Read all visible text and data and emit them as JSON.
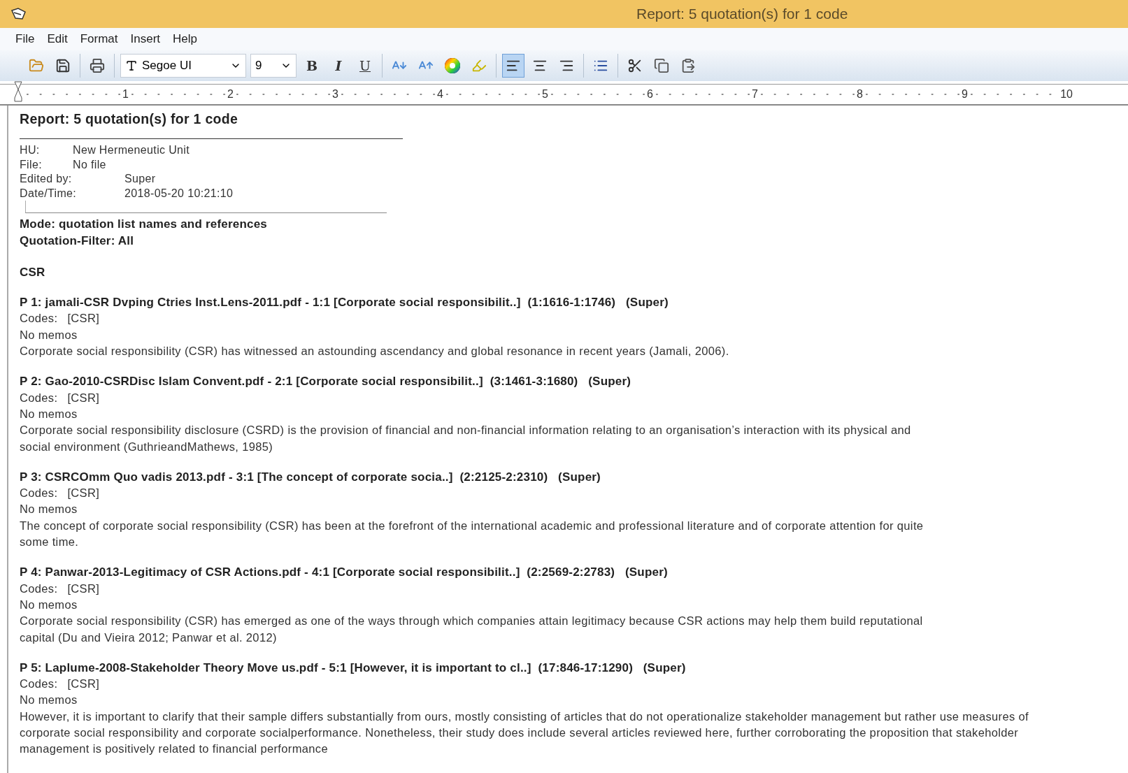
{
  "window": {
    "title": "Report: 5 quotation(s) for 1 code"
  },
  "menu": [
    "File",
    "Edit",
    "Format",
    "Insert",
    "Help"
  ],
  "toolbar": {
    "groups": [
      [
        {
          "kind": "open"
        },
        {
          "kind": "save"
        }
      ],
      [
        {
          "kind": "print"
        }
      ],
      [
        {
          "kind": "font",
          "value": "Segoe UI"
        },
        {
          "kind": "size",
          "value": "9"
        },
        {
          "kind": "bold",
          "label": "B"
        },
        {
          "kind": "italic",
          "label": "I"
        },
        {
          "kind": "underline",
          "label": "U"
        }
      ],
      [
        {
          "kind": "shrink"
        },
        {
          "kind": "grow"
        },
        {
          "kind": "color"
        },
        {
          "kind": "highlight"
        }
      ],
      [
        {
          "kind": "align-left",
          "selected": true
        },
        {
          "kind": "align-center",
          "selected": false
        },
        {
          "kind": "align-right",
          "selected": false
        }
      ],
      [
        {
          "kind": "bullets"
        }
      ],
      [
        {
          "kind": "cut"
        },
        {
          "kind": "copy"
        },
        {
          "kind": "paste"
        }
      ]
    ]
  },
  "ruler": [
    "1",
    "2",
    "3",
    "4",
    "5",
    "6",
    "7",
    "8",
    "9",
    "10"
  ],
  "document": {
    "title": "Report: 5 quotation(s) for 1 code",
    "meta": [
      {
        "label": "HU:",
        "value": "New Hermeneutic Unit"
      },
      {
        "label": "File:",
        "value": "No file"
      },
      {
        "label": "Edited by:",
        "value": "Super"
      },
      {
        "label": "Date/Time:",
        "value": "2018-05-20 10:21:10"
      }
    ],
    "mode": "Mode: quotation list names and references",
    "filter": "Quotation-Filter: All",
    "code": "CSR",
    "quotations": [
      {
        "heading": "P 1: jamali-CSR Dvping Ctries Inst.Lens-2011.pdf - 1:1 [Corporate social responsibilit..]  (1:1616-1:1746)   (Super)",
        "codes_label": "Codes:",
        "codes": "[CSR]",
        "memos": "No memos",
        "lines": [
          "Corporate social responsibility (CSR) has witnessed an astounding ascendancy and global resonance in recent years (Jamali, 2006)."
        ]
      },
      {
        "heading": "P 2: Gao-2010-CSRDisc Islam Convent.pdf - 2:1 [Corporate social responsibilit..]  (3:1461-3:1680)   (Super)",
        "codes_label": "Codes:",
        "codes": "[CSR]",
        "memos": "No memos",
        "lines": [
          "Corporate social responsibility disclosure (CSRD) is the provision of financial and non-financial information relating to an organisation’s interaction with its physical and",
          "social environment (GuthrieandMathews, 1985)"
        ]
      },
      {
        "heading": "P 3: CSRCOmm Quo vadis 2013.pdf - 3:1 [The concept of corporate socia..]  (2:2125-2:2310)   (Super)",
        "codes_label": "Codes:",
        "codes": "[CSR]",
        "memos": "No memos",
        "lines": [
          "The concept of corporate social responsibility (CSR) has been at the forefront of the international academic and professional literature and of corporate attention for quite",
          "some time."
        ]
      },
      {
        "heading": "P 4: Panwar-2013-Legitimacy of CSR Actions.pdf - 4:1 [Corporate social responsibilit..]  (2:2569-2:2783)   (Super)",
        "codes_label": "Codes:",
        "codes": "[CSR]",
        "memos": "No memos",
        "lines": [
          "Corporate social responsibility (CSR) has emerged as one of the ways through which companies attain legitimacy because CSR actions may help them build reputational",
          "capital (Du and Vieira 2012; Panwar et al. 2012)"
        ]
      },
      {
        "heading": "P 5: Laplume-2008-Stakeholder Theory Move us.pdf - 5:1 [However, it is important to cl..]  (17:846-17:1290)   (Super)",
        "codes_label": "Codes:",
        "codes": "[CSR]",
        "memos": "No memos",
        "lines": [
          "However, it is important to clarify that their sample differs substantially from ours, mostly consisting of articles that do not operationalize stakeholder management but rather use measures of",
          "corporate social responsibility and corporate socialperformance. Nonetheless, their study does include several articles reviewed here, further corroborating the proposition that stakeholder",
          "management is positively related to financial performance"
        ]
      }
    ]
  }
}
